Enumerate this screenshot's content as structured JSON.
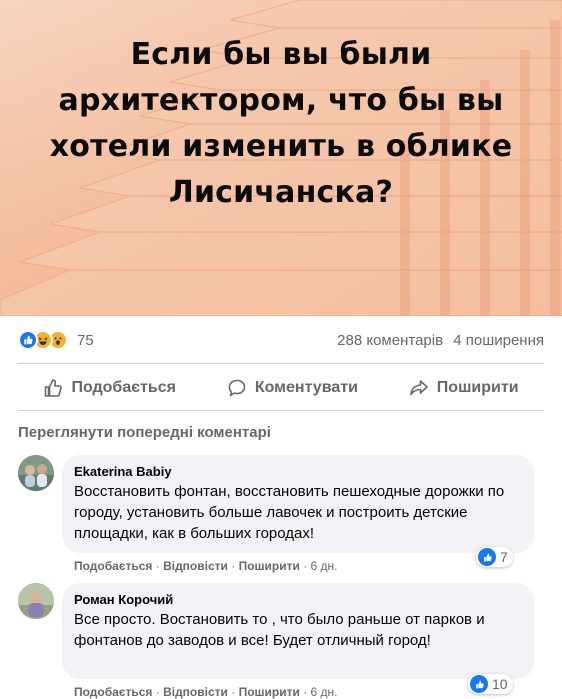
{
  "post": {
    "headline": "Если бы вы были архитектором, что бы вы хотели изменить в облике Лисичанска?"
  },
  "stats": {
    "reaction_icons": [
      "like-icon",
      "haha-icon",
      "wow-icon"
    ],
    "reaction_count": "75",
    "comments_count": "288 коментарів",
    "shares_count": "4 поширення"
  },
  "actions": {
    "like": "Подобається",
    "comment": "Коментувати",
    "share": "Поширити"
  },
  "comments_section": {
    "view_previous": "Переглянути попередні коментарі",
    "items": [
      {
        "author": "Ekaterina Babiy",
        "text": "Восстановить фонтан, восстановить пешеходные дорожки по городу, установить больше лавочек и построить детские площадки, как в больших городах!",
        "like": "Подобається",
        "reply": "Відповісти",
        "share": "Поширити",
        "time": "6 дн.",
        "reaction_count": "7"
      },
      {
        "author": "Роман Корочий",
        "text": "Все просто. Востановить то , что было раньше от парков и фонтанов до заводов и все! Будет отличный город!",
        "like": "Подобається",
        "reply": "Відповісти",
        "share": "Поширити",
        "time": "6 дн.",
        "reaction_count": "10"
      }
    ]
  },
  "colors": {
    "hero_background": "#f3bc9b",
    "like_blue": "#1877f2",
    "bubble_gray": "#f0f2f5",
    "secondary_text": "#65676b"
  }
}
